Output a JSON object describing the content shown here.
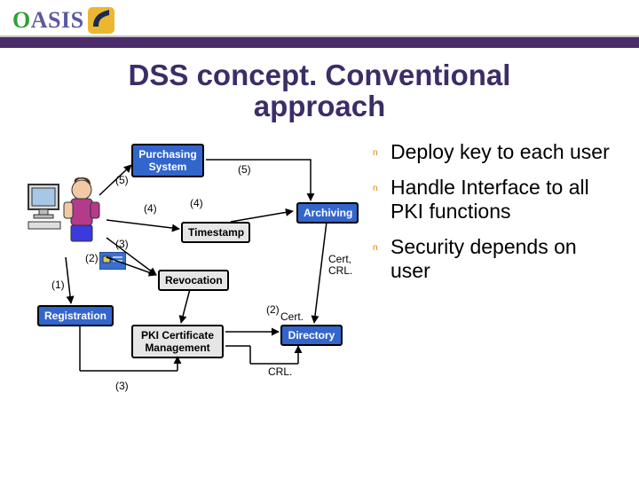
{
  "brand": {
    "name": "OASIS",
    "accent": "#4b2b6a",
    "logo_o_color": "#2fa038",
    "logo_text_main_color": "#5a5aa0",
    "logo_icon_bg": "#ecb730"
  },
  "title_line1": "DSS concept. Conventional",
  "title_line2": "approach",
  "bullets": {
    "mark": "n",
    "items": [
      "Deploy key to each user",
      "Handle Interface to all PKI functions",
      "Security depends on user"
    ]
  },
  "diagram": {
    "nodes": {
      "purchasing": "Purchasing\nSystem",
      "archiving": "Archiving",
      "timestamp": "Timestamp",
      "revocation": "Revocation",
      "registration": "Registration",
      "pkicert": "PKI Certificate\nManagement",
      "directory": "Directory"
    },
    "edge_labels": {
      "l1": "(1)",
      "l2a": "(2)",
      "l2b": "(2)",
      "l3a": "(3)",
      "l3b": "(3)",
      "l4a": "(4)",
      "l4b": "(4)",
      "l5a": "(5)",
      "l5b": "(5)",
      "cert": "Cert.",
      "cert_crl": "Cert,\nCRL.",
      "crl": "CRL."
    }
  }
}
